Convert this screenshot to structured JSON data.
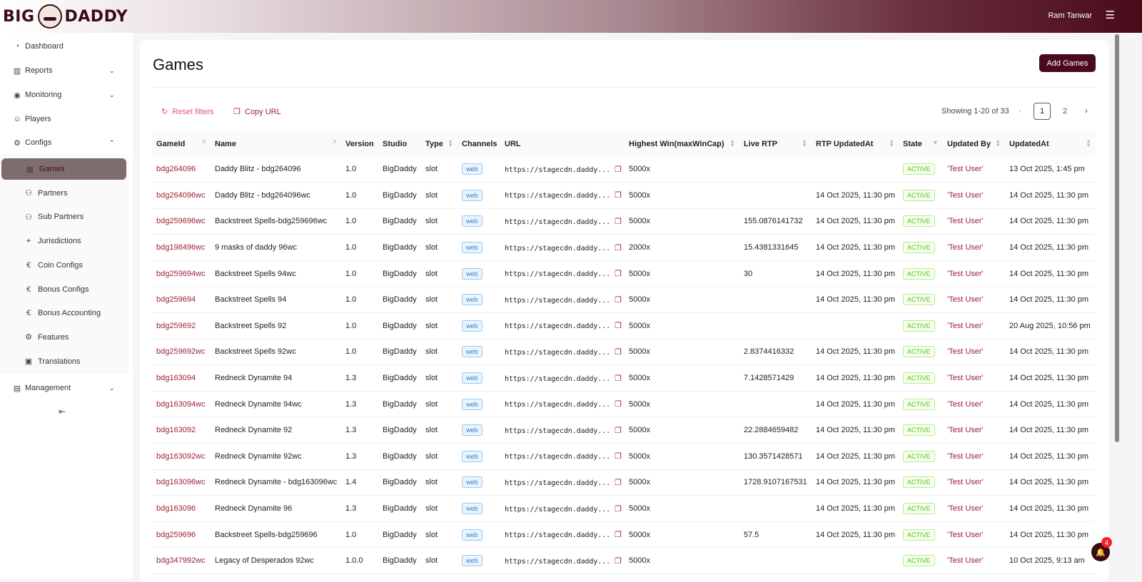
{
  "header": {
    "logo": "BIG DADDY",
    "user": "Ram Tanwar",
    "menu_icon": "hamburger-icon"
  },
  "sidebar": {
    "items": [
      {
        "label": "Dashboard",
        "icon": "pie-chart-icon"
      },
      {
        "label": "Reports",
        "icon": "bar-chart-icon",
        "chevron": "down"
      },
      {
        "label": "Monitoring",
        "icon": "eye-icon",
        "chevron": "down"
      },
      {
        "label": "Players",
        "icon": "smile-icon"
      },
      {
        "label": "Configs",
        "icon": "gear-icon",
        "chevron": "up"
      }
    ],
    "sub_items": [
      {
        "label": "Games",
        "active": true
      },
      {
        "label": "Partners"
      },
      {
        "label": "Sub Partners"
      },
      {
        "label": "Jurisdictions"
      },
      {
        "label": "Coin Configs"
      },
      {
        "label": "Bonus Configs"
      },
      {
        "label": "Bonus Accounting"
      },
      {
        "label": "Features"
      },
      {
        "label": "Translations"
      }
    ],
    "management": "Management"
  },
  "main": {
    "title": "Games",
    "add_button": "Add Games",
    "reset_filters": "Reset filters",
    "copy_url": "Copy URL",
    "showing": "Showing 1-20 of 33",
    "pages": [
      "1",
      "2"
    ],
    "current_page": "1"
  },
  "table": {
    "columns": [
      "GameId",
      "Name",
      "Version",
      "Studio",
      "Type",
      "Channels",
      "URL",
      "Highest Win(maxWinCap)",
      "Live RTP",
      "RTP UpdatedAt",
      "State",
      "Updated By",
      "UpdatedAt"
    ],
    "rows": [
      [
        "bdg264096",
        "Daddy Blitz - bdg264096",
        "1.0",
        "BigDaddy",
        "slot",
        "web",
        "https://stagecdn.daddy...",
        "5000x",
        "",
        "",
        "ACTIVE",
        "'Test User'",
        "13 Oct 2025, 1:45 pm"
      ],
      [
        "bdg264096wc",
        "Daddy Blitz - bdg264096wc",
        "1.0",
        "BigDaddy",
        "slot",
        "web",
        "https://stagecdn.daddy...",
        "5000x",
        "",
        "14 Oct 2025, 11:30 pm",
        "ACTIVE",
        "'Test User'",
        "14 Oct 2025, 11:30 pm"
      ],
      [
        "bdg259696wc",
        "Backstreet Spells-bdg259696wc",
        "1.0",
        "BigDaddy",
        "slot",
        "web",
        "https://stagecdn.daddy...",
        "5000x",
        "155.0876141732",
        "14 Oct 2025, 11:30 pm",
        "ACTIVE",
        "'Test User'",
        "14 Oct 2025, 11:30 pm"
      ],
      [
        "bdg198496wc",
        "9 masks of daddy 96wc",
        "1.0",
        "BigDaddy",
        "slot",
        "web",
        "https://stagecdn.daddy...",
        "2000x",
        "15.4381331645",
        "14 Oct 2025, 11:30 pm",
        "ACTIVE",
        "'Test User'",
        "14 Oct 2025, 11:30 pm"
      ],
      [
        "bdg259694wc",
        "Backstreet Spells 94wc",
        "1.0",
        "BigDaddy",
        "slot",
        "web",
        "https://stagecdn.daddy...",
        "5000x",
        "30",
        "14 Oct 2025, 11:30 pm",
        "ACTIVE",
        "'Test User'",
        "14 Oct 2025, 11:30 pm"
      ],
      [
        "bdg259694",
        "Backstreet Spells 94",
        "1.0",
        "BigDaddy",
        "slot",
        "web",
        "https://stagecdn.daddy...",
        "5000x",
        "",
        "14 Oct 2025, 11:30 pm",
        "ACTIVE",
        "'Test User'",
        "14 Oct 2025, 11:30 pm"
      ],
      [
        "bdg259692",
        "Backstreet Spells 92",
        "1.0",
        "BigDaddy",
        "slot",
        "web",
        "https://stagecdn.daddy...",
        "5000x",
        "",
        "",
        "ACTIVE",
        "'Test User'",
        "20 Aug 2025, 10:56 pm"
      ],
      [
        "bdg259692wc",
        "Backstreet Spells 92wc",
        "1.0",
        "BigDaddy",
        "slot",
        "web",
        "https://stagecdn.daddy...",
        "5000x",
        "2.8374416332",
        "14 Oct 2025, 11:30 pm",
        "ACTIVE",
        "'Test User'",
        "14 Oct 2025, 11:30 pm"
      ],
      [
        "bdg163094",
        "Redneck Dynamite 94",
        "1.3",
        "BigDaddy",
        "slot",
        "web",
        "https://stagecdn.daddy...",
        "5000x",
        "7.1428571429",
        "14 Oct 2025, 11:30 pm",
        "ACTIVE",
        "'Test User'",
        "14 Oct 2025, 11:30 pm"
      ],
      [
        "bdg163094wc",
        "Redneck Dynamite 94wc",
        "1.3",
        "BigDaddy",
        "slot",
        "web",
        "https://stagecdn.daddy...",
        "5000x",
        "",
        "14 Oct 2025, 11:30 pm",
        "ACTIVE",
        "'Test User'",
        "14 Oct 2025, 11:30 pm"
      ],
      [
        "bdg163092",
        "Redneck Dynamite 92",
        "1.3",
        "BigDaddy",
        "slot",
        "web",
        "https://stagecdn.daddy...",
        "5000x",
        "22.2884659482",
        "14 Oct 2025, 11:30 pm",
        "ACTIVE",
        "'Test User'",
        "14 Oct 2025, 11:30 pm"
      ],
      [
        "bdg163092wc",
        "Redneck Dynamite 92wc",
        "1.3",
        "BigDaddy",
        "slot",
        "web",
        "https://stagecdn.daddy...",
        "5000x",
        "130.3571428571",
        "14 Oct 2025, 11:30 pm",
        "ACTIVE",
        "'Test User'",
        "14 Oct 2025, 11:30 pm"
      ],
      [
        "bdg163096wc",
        "Redneck Dynamite - bdg163096wc",
        "1.4",
        "BigDaddy",
        "slot",
        "web",
        "https://stagecdn.daddy...",
        "5000x",
        "1728.9107167531",
        "14 Oct 2025, 11:30 pm",
        "ACTIVE",
        "'Test User'",
        "14 Oct 2025, 11:30 pm"
      ],
      [
        "bdg163096",
        "Redneck Dynamite 96",
        "1.3",
        "BigDaddy",
        "slot",
        "web",
        "https://stagecdn.daddy...",
        "5000x",
        "",
        "14 Oct 2025, 11:30 pm",
        "ACTIVE",
        "'Test User'",
        "14 Oct 2025, 11:30 pm"
      ],
      [
        "bdg259696",
        "Backstreet Spells-bdg259696",
        "1.0",
        "BigDaddy",
        "slot",
        "web",
        "https://stagecdn.daddy...",
        "5000x",
        "57.5",
        "14 Oct 2025, 11:30 pm",
        "ACTIVE",
        "'Test User'",
        "14 Oct 2025, 11:30 pm"
      ],
      [
        "bdg347992wc",
        "Legacy of Desperados 92wc",
        "1.0.0",
        "BigDaddy",
        "slot",
        "web",
        "https://stagecdn.daddy...",
        "5000x",
        "",
        "",
        "ACTIVE",
        "'Test User'",
        "10 Oct 2025, 9:13 am"
      ]
    ]
  },
  "notifications": {
    "count": "4"
  },
  "colors": {
    "brand": "#4a0a1c",
    "link": "#9b2335",
    "active_green": "#52c41a",
    "channel_blue": "#2f7fd0"
  }
}
